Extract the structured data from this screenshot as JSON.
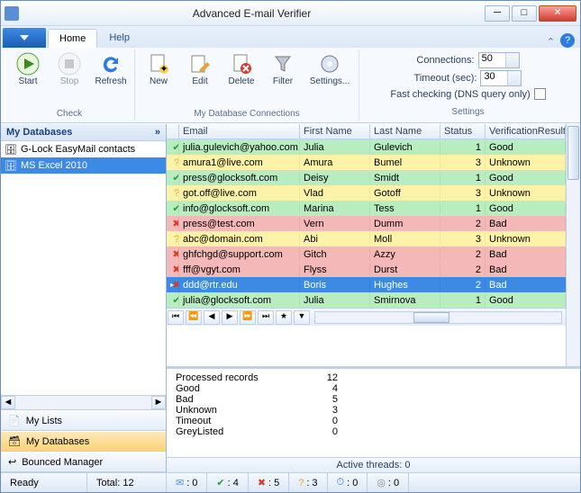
{
  "window": {
    "title": "Advanced E-mail Verifier"
  },
  "tabs": {
    "file": "",
    "home": "Home",
    "help": "Help"
  },
  "ribbon": {
    "check": {
      "start": "Start",
      "stop": "Stop",
      "refresh": "Refresh",
      "title": "Check"
    },
    "db": {
      "new": "New",
      "edit": "Edit",
      "delete": "Delete",
      "filter": "Filter",
      "settings": "Settings...",
      "title": "My Database Connections"
    },
    "settings": {
      "connections_label": "Connections:",
      "connections_value": "50",
      "timeout_label": "Timeout (sec):",
      "timeout_value": "30",
      "fastcheck_label": "Fast checking (DNS query only)",
      "title": "Settings"
    }
  },
  "sidebar": {
    "header": "My Databases",
    "items": [
      {
        "label": "G-Lock EasyMail contacts"
      },
      {
        "label": "MS Excel 2010"
      }
    ],
    "nav": {
      "lists": "My Lists",
      "databases": "My Databases",
      "bounced": "Bounced Manager"
    }
  },
  "grid": {
    "cols": {
      "email": "Email",
      "first": "First Name",
      "last": "Last Name",
      "status": "Status",
      "result": "VerificationResult"
    },
    "rows": [
      {
        "status": "good",
        "email": "julia.gulevich@yahoo.com",
        "first": "Julia",
        "last": "Gulevich",
        "code": "1",
        "result": "Good"
      },
      {
        "status": "unknown",
        "email": "amura1@live.com",
        "first": "Amura",
        "last": "Bumel",
        "code": "3",
        "result": "Unknown"
      },
      {
        "status": "good",
        "email": "press@glocksoft.com",
        "first": "Deisy",
        "last": "Smidt",
        "code": "1",
        "result": "Good"
      },
      {
        "status": "unknown",
        "email": "got.off@live.com",
        "first": "Vlad",
        "last": "Gotoff",
        "code": "3",
        "result": "Unknown"
      },
      {
        "status": "good",
        "email": "info@glocksoft.com",
        "first": "Marina",
        "last": "Tess",
        "code": "1",
        "result": "Good"
      },
      {
        "status": "bad",
        "email": "press@test.com",
        "first": "Vern",
        "last": "Dumm",
        "code": "2",
        "result": "Bad"
      },
      {
        "status": "unknown",
        "email": "abc@domain.com",
        "first": "Abi",
        "last": "Moll",
        "code": "3",
        "result": "Unknown"
      },
      {
        "status": "bad",
        "email": "ghfchgd@support.com",
        "first": "Gitch",
        "last": "Azzy",
        "code": "2",
        "result": "Bad"
      },
      {
        "status": "bad",
        "email": "fff@vgyt.com",
        "first": "Flyss",
        "last": "Durst",
        "code": "2",
        "result": "Bad"
      },
      {
        "status": "bad",
        "email": "ddd@rtr.edu",
        "first": "Boris",
        "last": "Hughes",
        "code": "2",
        "result": "Bad",
        "selected": true
      },
      {
        "status": "good",
        "email": "julia@glocksoft.com",
        "first": "Julia",
        "last": "Smirnova",
        "code": "1",
        "result": "Good"
      }
    ]
  },
  "stats": {
    "rows": [
      {
        "k": "Processed records",
        "v": "12"
      },
      {
        "k": "Good",
        "v": "4"
      },
      {
        "k": "Bad",
        "v": "5"
      },
      {
        "k": "Unknown",
        "v": "3"
      },
      {
        "k": "Timeout",
        "v": "0"
      },
      {
        "k": "GreyListed",
        "v": "0"
      }
    ],
    "active_threads": "Active threads: 0"
  },
  "statusbar": {
    "ready": "Ready",
    "total": "Total: 12",
    "new": "0",
    "good": "4",
    "bad": "5",
    "unknown": "3",
    "timeout": "0",
    "grey": "0"
  }
}
